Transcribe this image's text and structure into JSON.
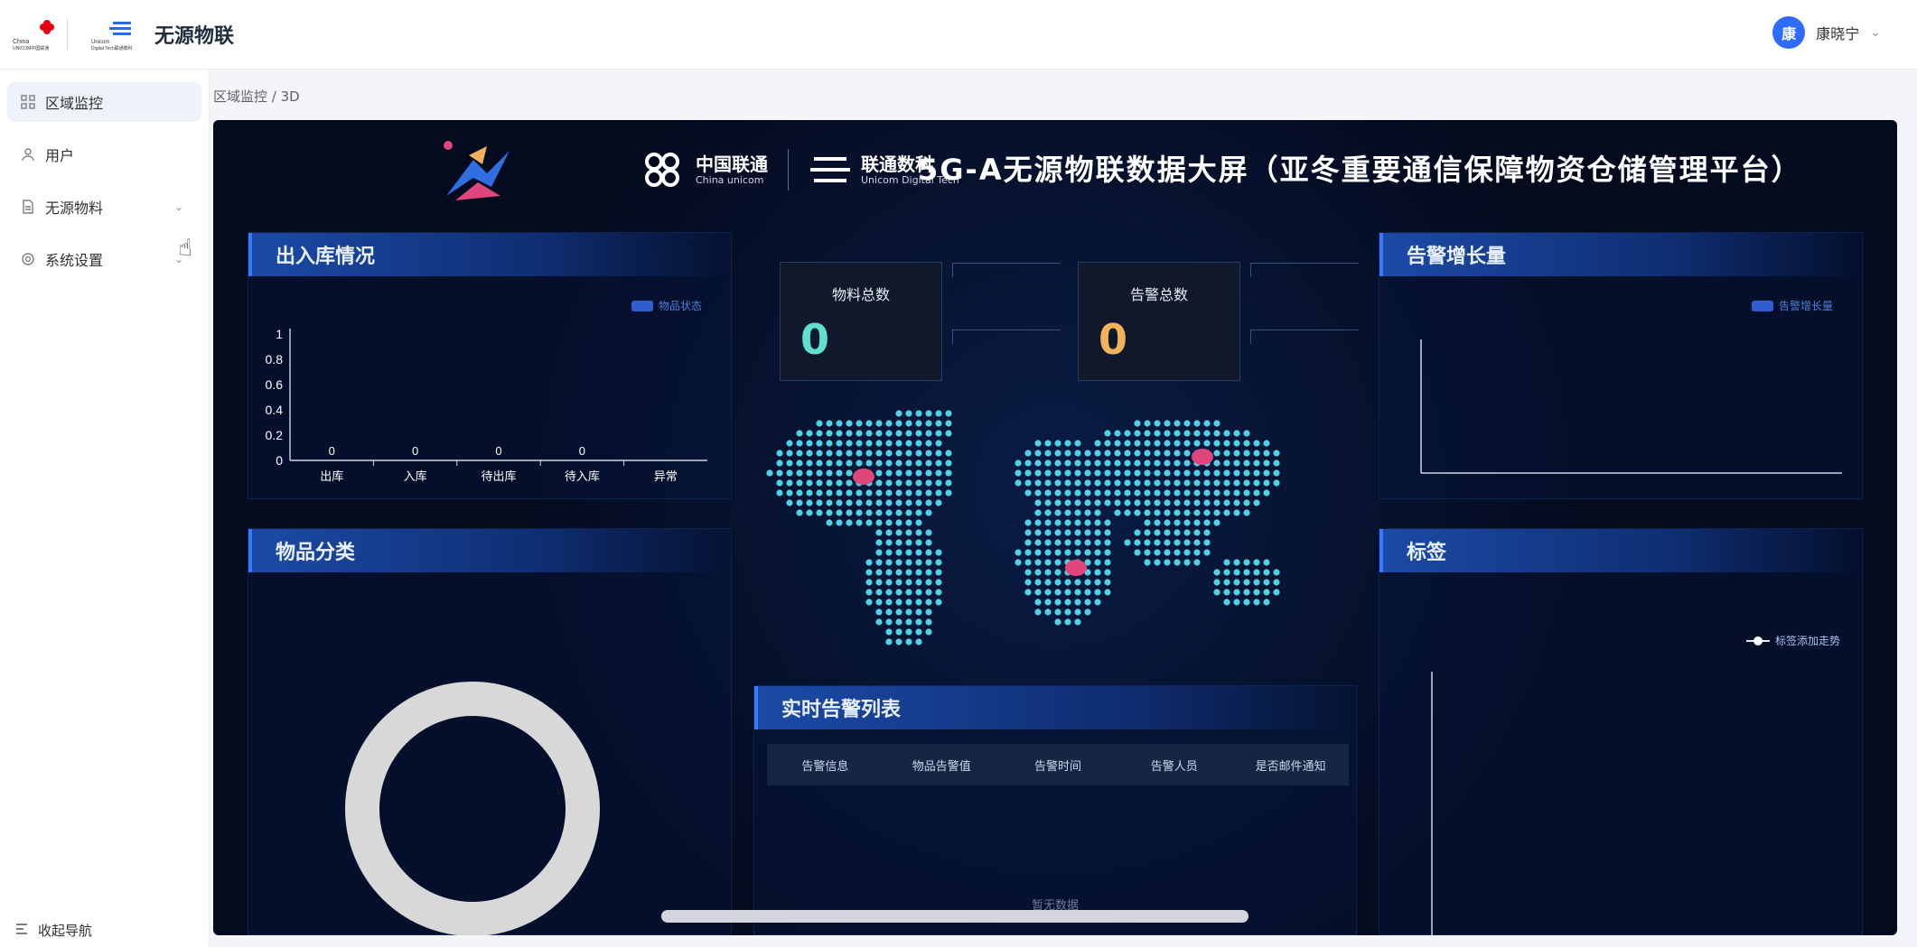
{
  "header": {
    "app_title": "无源物联",
    "user_initial": "康",
    "user_name": "康晓宁",
    "logo1_text": "China Unicom中国联通",
    "logo2_text": "Unicom Digital Tech联通数科"
  },
  "sidebar": {
    "items": [
      {
        "label": "区域监控",
        "icon": "grid-icon",
        "active": true
      },
      {
        "label": "用户",
        "icon": "user-icon"
      },
      {
        "label": "无源物料",
        "icon": "document-icon",
        "expandable": true
      },
      {
        "label": "系统设置",
        "icon": "gear-icon",
        "expandable": true
      }
    ],
    "collapse_label": "收起导航"
  },
  "breadcrumb": "区域监控 / 3D",
  "dashboard": {
    "title": "5G-A无源物联数据大屏（亚冬重要通信保障物资仓储管理平台）",
    "brand_cn_main": "中国联通",
    "brand_cn_sub": "China unicom",
    "brand_dt_main": "联通数科",
    "brand_dt_sub": "Unicom Digital Tech",
    "panels": {
      "inout": {
        "title": "出入库情况",
        "legend": "物品状态"
      },
      "category": {
        "title": "物品分类"
      },
      "alarm_growth": {
        "title": "告警增长量",
        "legend": "告警增长量"
      },
      "tags": {
        "title": "标签",
        "legend": "标签添加走势"
      },
      "realtime": {
        "title": "实时告警列表",
        "columns": [
          "告警信息",
          "物品告警值",
          "告警时间",
          "告警人员",
          "是否邮件通知"
        ],
        "empty_text": "暂无数据"
      }
    },
    "stats": {
      "material_label": "物料总数",
      "material_value": "0",
      "alarm_label": "告警总数",
      "alarm_value": "0"
    },
    "colors": {
      "accent_teal": "#5fe0cf",
      "accent_orange": "#f2b25c",
      "map_dot": "#4fd1e6",
      "hotspot": "#e0457b"
    }
  },
  "chart_data": {
    "type": "bar",
    "categories": [
      "出库",
      "入库",
      "待出库",
      "待入库",
      "异常"
    ],
    "series": [
      {
        "name": "物品状态",
        "values": [
          0,
          0,
          0,
          0,
          null
        ]
      }
    ],
    "data_labels": [
      "0",
      "0",
      "0",
      "0"
    ],
    "yticks": [
      "0",
      "0.2",
      "0.4",
      "0.6",
      "0.8",
      "1"
    ],
    "ylim": [
      0,
      1
    ],
    "legend": "top-right"
  }
}
